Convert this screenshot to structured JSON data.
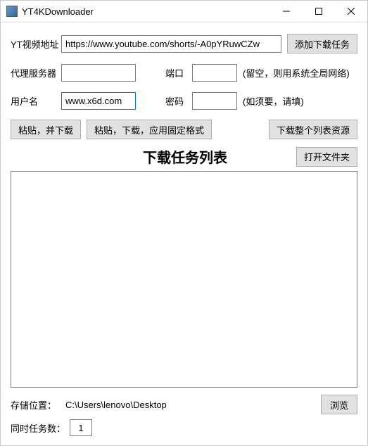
{
  "titlebar": {
    "title": "YT4KDownloader"
  },
  "form": {
    "url_label": "YT视频地址",
    "url_value": "https://www.youtube.com/shorts/-A0pYRuwCZw",
    "add_task_btn": "添加下载任务",
    "proxy_label": "代理服务器",
    "proxy_value": "",
    "port_label": "端口",
    "port_value": "",
    "proxy_hint": "(留空，则用系统全局网络)",
    "user_label": "用户名",
    "user_value": "www.x6d.com",
    "pass_label": "密码",
    "pass_value": "",
    "cred_hint": "(如须要，请填)",
    "paste_download_btn": "粘贴，并下载",
    "paste_format_btn": "粘贴，下载，应用固定格式",
    "download_list_btn": "下载整个列表资源"
  },
  "tasks": {
    "header": "下载任务列表",
    "open_folder_btn": "打开文件夹"
  },
  "footer": {
    "storage_label": "存储位置：",
    "storage_path": "C:\\Users\\lenovo\\Desktop",
    "browse_btn": "浏览",
    "concurrent_label": "同时任务数：",
    "concurrent_value": "1"
  }
}
